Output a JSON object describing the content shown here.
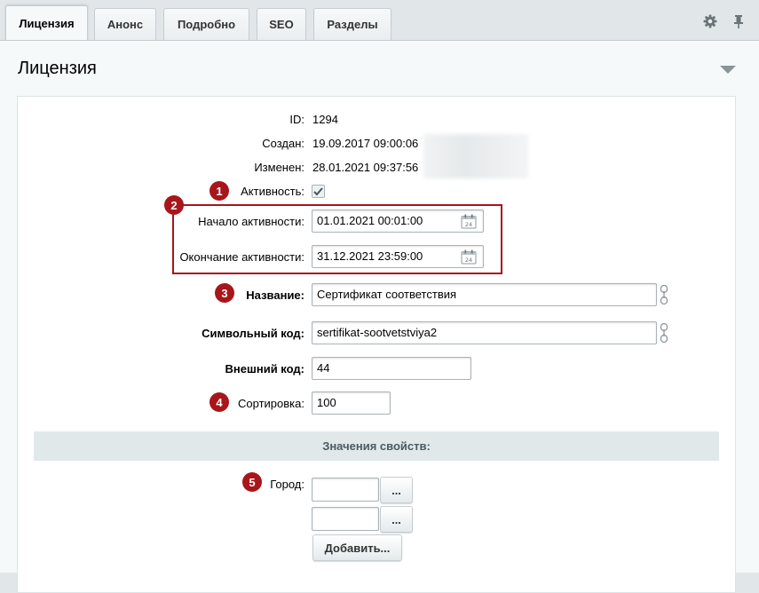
{
  "tabs": [
    {
      "label": "Лицензия",
      "active": true
    },
    {
      "label": "Анонс"
    },
    {
      "label": "Подробно"
    },
    {
      "label": "SEO"
    },
    {
      "label": "Разделы"
    }
  ],
  "toolbar": {
    "settings_icon": "gear-icon",
    "pin_icon": "pin-icon"
  },
  "panel": {
    "title": "Лицензия"
  },
  "fields": {
    "id": {
      "label": "ID:",
      "value": "1294"
    },
    "created": {
      "label": "Создан:",
      "value": "19.09.2017 09:00:06"
    },
    "modified": {
      "label": "Изменен:",
      "value": "28.01.2021 09:37:56"
    },
    "active": {
      "label": "Активность:",
      "checked": true
    },
    "active_from": {
      "label": "Начало активности:",
      "value": "01.01.2021 00:01:00"
    },
    "active_to": {
      "label": "Окончание активности:",
      "value": "31.12.2021 23:59:00"
    },
    "name": {
      "label": "Название:",
      "value": "Сертификат соответствия"
    },
    "code": {
      "label": "Символьный код:",
      "value": "sertifikat-sootvetstviya2"
    },
    "xml_id": {
      "label": "Внешний код:",
      "value": "44"
    },
    "sort": {
      "label": "Сортировка:",
      "value": "100"
    }
  },
  "properties": {
    "section_title": "Значения свойств:",
    "city_label": "Город:",
    "browse_label": "...",
    "add_label": "Добавить..."
  },
  "badges": [
    "1",
    "2",
    "3",
    "4",
    "5"
  ],
  "colors": {
    "accent_red": "#a8151a",
    "panel_bg": "#f5f9f9",
    "section_bg": "#e0e8ea"
  }
}
